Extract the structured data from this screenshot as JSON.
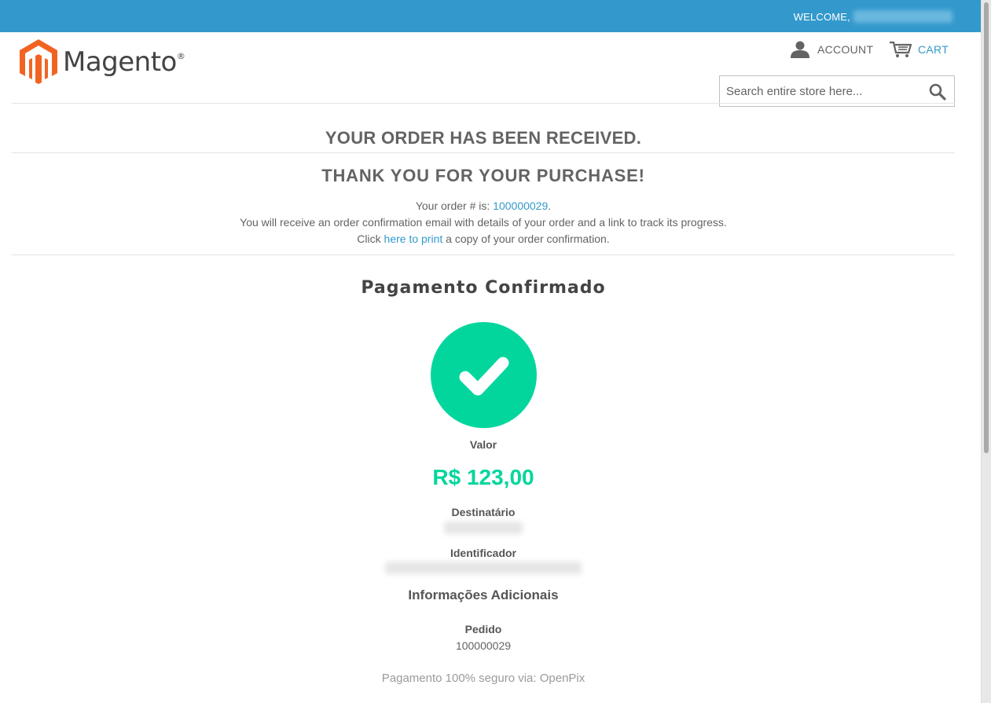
{
  "header": {
    "welcome_label": "WELCOME,",
    "account_label": "ACCOUNT",
    "cart_label": "CART",
    "search_placeholder": "Search entire store here...",
    "logo_text": "Magento",
    "logo_mark": "®"
  },
  "success": {
    "heading": "YOUR ORDER HAS BEEN RECEIVED.",
    "subheading": "THANK YOU FOR YOUR PURCHASE!",
    "order_prefix": "Your order # is: ",
    "order_number": "100000029",
    "order_suffix": ".",
    "email_notice": "You will receive an order confirmation email with details of your order and a link to track its progress.",
    "print_prefix": "Click ",
    "print_link": "here to print",
    "print_suffix": " a copy of your order confirmation."
  },
  "payment": {
    "title": "Pagamento Confirmado",
    "value_label": "Valor",
    "amount": "R$ 123,00",
    "recipient_label": "Destinatário",
    "identifier_label": "Identificador",
    "additional_title": "Informações Adicionais",
    "order_label": "Pedido",
    "order_value": "100000029",
    "secure_text": "Pagamento 100% seguro via: OpenPix"
  },
  "colors": {
    "brand_blue": "#3399cc",
    "success_green": "#03d69d",
    "logo_orange": "#f26322"
  },
  "icons": {
    "account": "user-icon",
    "cart": "cart-icon",
    "search": "search-icon",
    "check": "check-icon"
  }
}
